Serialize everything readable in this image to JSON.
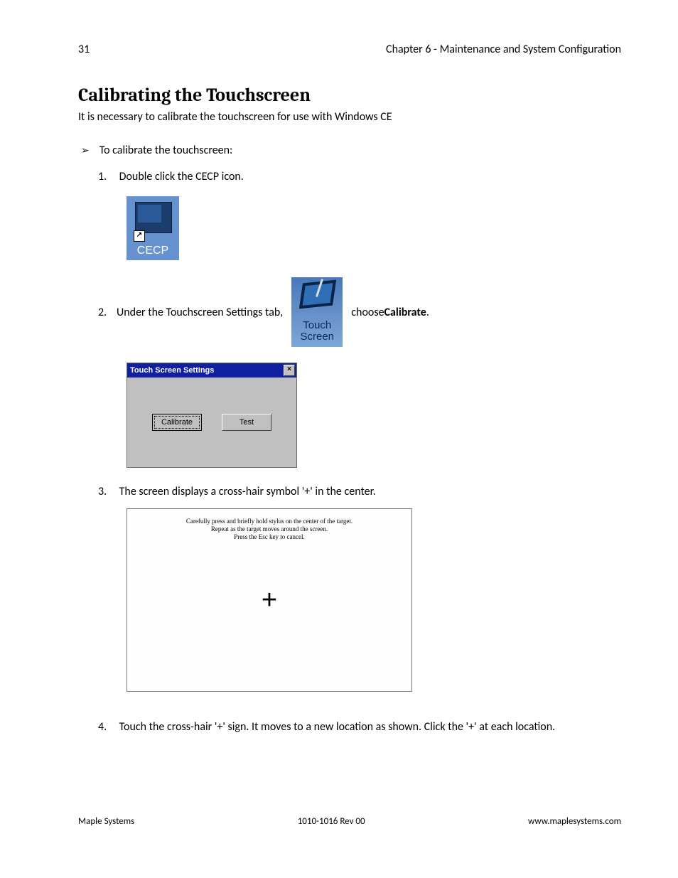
{
  "page_number": "31",
  "chapter": "Chapter 6 - Maintenance and System Configuration",
  "heading": "Calibrating the Touchscreen",
  "intro": "It is necessary to calibrate the touchscreen for use with Windows CE",
  "procedure_title": "To calibrate the touchscreen:",
  "steps": {
    "s1_num": "1.",
    "s1_text": "Double click the CECP icon.",
    "s2_num": "2.",
    "s2_pre": "Under the Touchscreen Settings tab, ",
    "s2_post": " choose ",
    "s2_bold": "Calibrate",
    "s2_end": ".",
    "s3_num": "3.",
    "s3_text": "The screen displays a cross-hair symbol '+' in the center.",
    "s4_num": "4.",
    "s4_text": "Touch the cross-hair '+' sign.  It moves to a new location as shown.  Click the '+' at each location."
  },
  "cecp_icon_label": "CECP",
  "cecp_shortcut_glyph": "↗",
  "ts_icon_label": "Touch\nScreen",
  "dialog": {
    "title": "Touch Screen Settings",
    "close_glyph": "×",
    "btn_calibrate": "Calibrate",
    "btn_test": "Test"
  },
  "calibration_instructions": "Carefully press and briefly hold stylus on the center of the target.\nRepeat as the target moves around the screen.\nPress the Esc key to cancel.",
  "crosshair_glyph": "+",
  "footer": {
    "left": "Maple Systems",
    "center": "1010-1016 Rev 00",
    "right": "www.maplesystems.com"
  }
}
